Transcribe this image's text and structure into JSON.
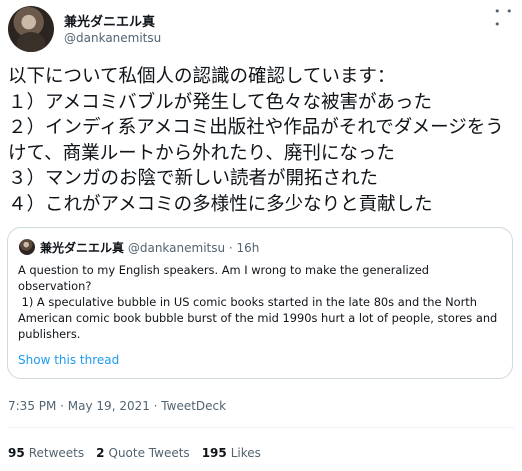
{
  "author": {
    "name": "兼光ダニエル真",
    "handle": "@dankanemitsu"
  },
  "tweet": {
    "text": "以下について私個人の認識の確認しています：\n１）アメコミバブルが発生して色々な被害があった\n２）インディ系アメコミ出版社や作品がそれでダメージをうけて、商業ルートから外れたり、廃刊になった\n３）マンガのお陰で新しい読者が開拓された\n４）これがアメコミの多様性に多少なりと貢献した"
  },
  "quote": {
    "name": "兼光ダニエル真",
    "handle_time": "@dankanemitsu · 16h",
    "text": "A question to my English speakers. Am I wrong to make the generalized observation?\n 1) A speculative bubble in US comic books started in the late 80s and the North American comic book bubble burst of the mid 1990s hurt a lot of people, stores and publishers.",
    "show_thread": "Show this thread"
  },
  "meta": {
    "line": "7:35 PM · May 19, 2021 · TweetDeck"
  },
  "stats": {
    "retweets_count": "95",
    "retweets_label": "Retweets",
    "quotes_count": "2",
    "quotes_label": "Quote Tweets",
    "likes_count": "195",
    "likes_label": "Likes"
  },
  "icons": {
    "more": "more-icon"
  }
}
